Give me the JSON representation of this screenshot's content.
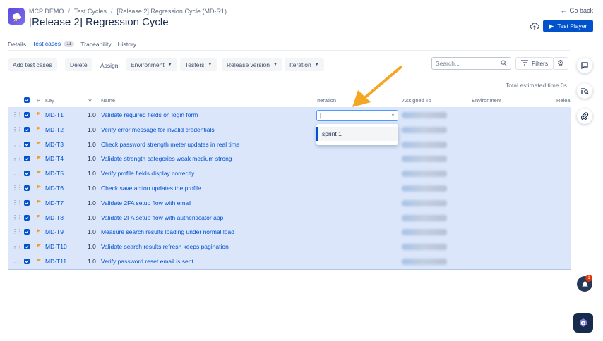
{
  "breadcrumb": {
    "project": "MCP DEMO",
    "section": "Test Cycles",
    "current": "[Release 2] Regression Cycle (MD-R1)"
  },
  "page_title": "[Release 2] Regression Cycle",
  "go_back": "Go back",
  "test_player": "Test Player",
  "tabs": {
    "details": "Details",
    "test_cases": "Test cases",
    "test_cases_count": "11",
    "traceability": "Traceability",
    "history": "History"
  },
  "toolbar": {
    "add": "Add test cases",
    "delete": "Delete",
    "assign": "Assign:",
    "environment": "Environment",
    "testers": "Testers",
    "release_version": "Release version",
    "iteration": "Iteration",
    "filters": "Filters"
  },
  "search": {
    "placeholder": "Search..."
  },
  "total_time": "Total estimated time 0s",
  "columns": {
    "p": "P",
    "key": "Key",
    "v": "V",
    "name": "Name",
    "iteration": "Iteration",
    "assigned": "Assigned To",
    "environment": "Environment",
    "release": "Relea"
  },
  "rows": [
    {
      "key": "MD-T1",
      "v": "1.0",
      "name": "Validate required fields on login form"
    },
    {
      "key": "MD-T2",
      "v": "1.0",
      "name": "Verify error message for invalid credentials"
    },
    {
      "key": "MD-T3",
      "v": "1.0",
      "name": "Check password strength meter updates in real time"
    },
    {
      "key": "MD-T4",
      "v": "1.0",
      "name": "Validate strength categories weak medium strong"
    },
    {
      "key": "MD-T5",
      "v": "1.0",
      "name": "Verify profile fields display correctly"
    },
    {
      "key": "MD-T6",
      "v": "1.0",
      "name": "Check save action updates the profile"
    },
    {
      "key": "MD-T7",
      "v": "1.0",
      "name": "Validate 2FA setup flow with email"
    },
    {
      "key": "MD-T8",
      "v": "1.0",
      "name": "Validate 2FA setup flow with authenticator app"
    },
    {
      "key": "MD-T9",
      "v": "1.0",
      "name": "Measure search results loading under normal load"
    },
    {
      "key": "MD-T10",
      "v": "1.0",
      "name": "Validate search results refresh keeps pagination"
    },
    {
      "key": "MD-T11",
      "v": "1.0",
      "name": "Verify password reset email is sent"
    }
  ],
  "iteration_dropdown": {
    "value": "|",
    "options": [
      "sprint 1"
    ]
  },
  "notification_count": "1",
  "colors": {
    "accent": "#0052cc",
    "selected_row": "#dbe6fb",
    "arrow": "#f5a623"
  }
}
